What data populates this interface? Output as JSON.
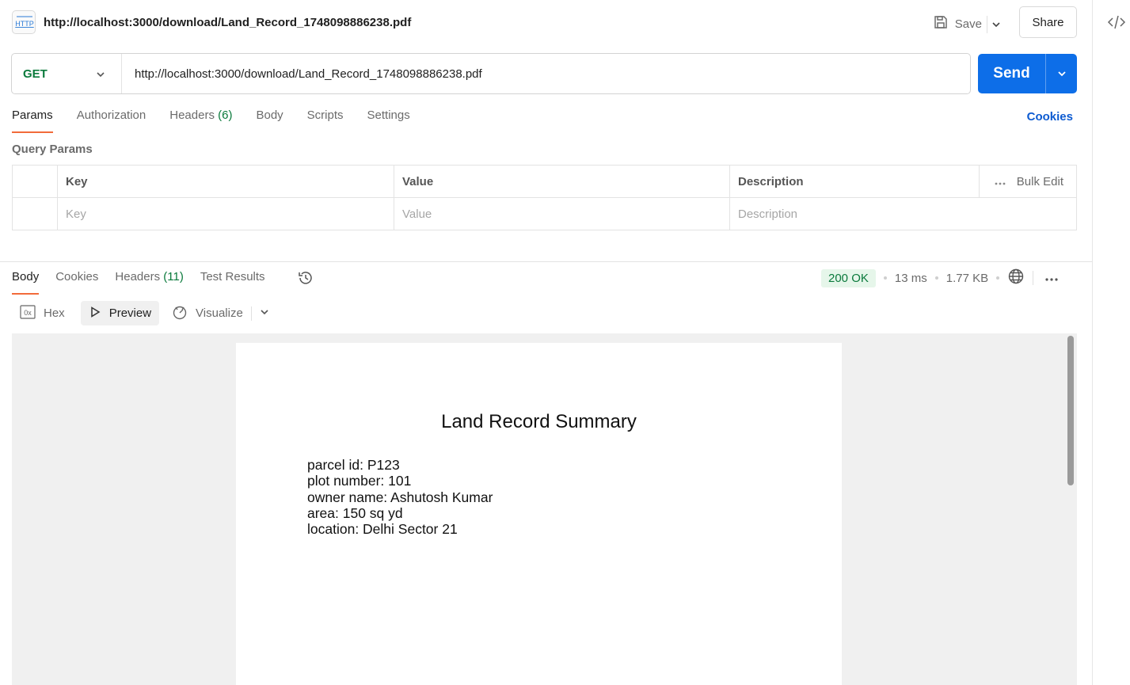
{
  "header": {
    "title": "http://localhost:3000/download/Land_Record_1748098886238.pdf",
    "save_label": "Save",
    "share_label": "Share"
  },
  "request": {
    "method": "GET",
    "url": "http://localhost:3000/download/Land_Record_1748098886238.pdf",
    "send_label": "Send"
  },
  "req_tabs": {
    "params": "Params",
    "authorization": "Authorization",
    "headers": "Headers",
    "headers_count": "(6)",
    "body": "Body",
    "scripts": "Scripts",
    "settings": "Settings",
    "cookies": "Cookies"
  },
  "query_params": {
    "title": "Query Params",
    "columns": {
      "key": "Key",
      "value": "Value",
      "description": "Description"
    },
    "bulk_edit": "Bulk Edit",
    "placeholders": {
      "key": "Key",
      "value": "Value",
      "description": "Description"
    }
  },
  "response": {
    "tabs": {
      "body": "Body",
      "cookies": "Cookies",
      "headers": "Headers",
      "headers_count": "(11)",
      "test_results": "Test Results"
    },
    "status": "200 OK",
    "time": "13 ms",
    "size": "1.77 KB",
    "view": {
      "hex": "Hex",
      "preview": "Preview",
      "visualize": "Visualize"
    }
  },
  "pdf": {
    "title": "Land Record Summary",
    "lines": [
      "parcel id: P123",
      "plot number: 101",
      "owner name: Ashutosh Kumar",
      "area: 150 sq yd",
      "location: Delhi Sector 21"
    ]
  },
  "colors": {
    "accent": "#0d6ee8",
    "get_method": "#0b7a3c",
    "active_tab": "#f26b3a",
    "status_ok_bg": "#e6f6ea"
  }
}
